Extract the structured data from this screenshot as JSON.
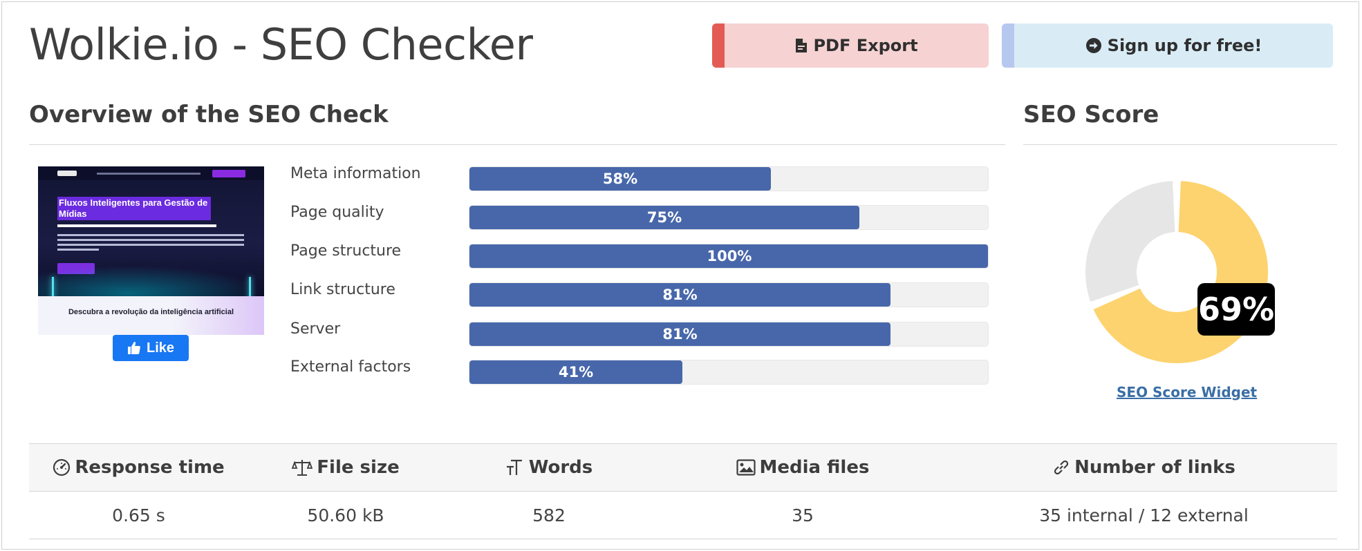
{
  "header": {
    "title": "Wolkie.io - SEO Checker",
    "pdf_label": "PDF Export",
    "signup_label": "Sign up for free!"
  },
  "overview": {
    "heading": "Overview of the SEO Check",
    "screenshot": {
      "hero_title": "Fluxos Inteligentes para Gestão de Mídias",
      "lower_title": "Descubra a revolução da inteligência artificial"
    },
    "like_label": "Like",
    "metrics": [
      {
        "label": "Meta information",
        "value": 58,
        "text": "58%"
      },
      {
        "label": "Page quality",
        "value": 75,
        "text": "75%"
      },
      {
        "label": "Page structure",
        "value": 100,
        "text": "100%"
      },
      {
        "label": "Link structure",
        "value": 81,
        "text": "81%"
      },
      {
        "label": "Server",
        "value": 81,
        "text": "81%"
      },
      {
        "label": "External factors",
        "value": 41,
        "text": "41%"
      }
    ]
  },
  "seo_score": {
    "heading": "SEO Score",
    "value": 69,
    "text": "69%",
    "widget_link": "SEO Score Widget",
    "colors": {
      "fill": "#fdd36f",
      "rest": "#e6e6e6"
    }
  },
  "stats": {
    "headers": [
      {
        "label": "Response time",
        "icon": "gauge-icon"
      },
      {
        "label": "File size",
        "icon": "balance-scale-icon"
      },
      {
        "label": "Words",
        "icon": "text-height-icon"
      },
      {
        "label": "Media files",
        "icon": "image-icon"
      },
      {
        "label": "Number of links",
        "icon": "link-icon"
      }
    ],
    "values": [
      "0.65 s",
      "50.60 kB",
      "582",
      "35",
      "35 internal / 12 external"
    ]
  },
  "colors": {
    "bar": "#4767aa",
    "pdf_accent": "#e35b55",
    "signup_accent": "#b6c8ef",
    "like": "#1877f2"
  }
}
